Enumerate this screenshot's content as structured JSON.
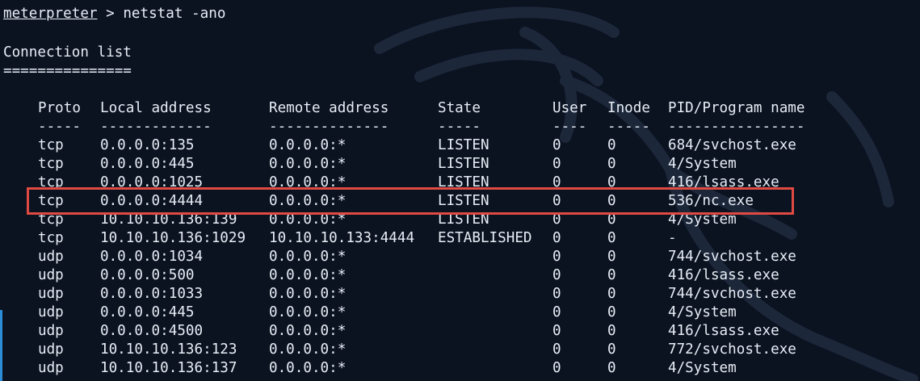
{
  "terminal": {
    "prompt": "meterpreter",
    "prompt_separator": " > ",
    "command": "netstat -ano",
    "section_title": "Connection list",
    "section_underline": "==============="
  },
  "table": {
    "headers": [
      "Proto",
      "Local address",
      "Remote address",
      "State",
      "User",
      "Inode",
      "PID/Program name"
    ],
    "header_underlines": [
      "-----",
      "-------------",
      "--------------",
      "-----",
      "----",
      "-----",
      "----------------"
    ],
    "rows": [
      [
        "tcp",
        "0.0.0.0:135",
        "0.0.0.0:*",
        "LISTEN",
        "0",
        "0",
        "684/svchost.exe"
      ],
      [
        "tcp",
        "0.0.0.0:445",
        "0.0.0.0:*",
        "LISTEN",
        "0",
        "0",
        "4/System"
      ],
      [
        "tcp",
        "0.0.0.0:1025",
        "0.0.0.0:*",
        "LISTEN",
        "0",
        "0",
        "416/lsass.exe"
      ],
      [
        "tcp",
        "0.0.0.0:4444",
        "0.0.0.0:*",
        "LISTEN",
        "0",
        "0",
        "536/nc.exe"
      ],
      [
        "tcp",
        "10.10.10.136:139",
        "0.0.0.0:*",
        "LISTEN",
        "0",
        "0",
        "4/System"
      ],
      [
        "tcp",
        "10.10.10.136:1029",
        "10.10.10.133:4444",
        "ESTABLISHED",
        "0",
        "0",
        "-"
      ],
      [
        "udp",
        "0.0.0.0:1034",
        "0.0.0.0:*",
        "",
        "0",
        "0",
        "744/svchost.exe"
      ],
      [
        "udp",
        "0.0.0.0:500",
        "0.0.0.0:*",
        "",
        "0",
        "0",
        "416/lsass.exe"
      ],
      [
        "udp",
        "0.0.0.0:1033",
        "0.0.0.0:*",
        "",
        "0",
        "0",
        "744/svchost.exe"
      ],
      [
        "udp",
        "0.0.0.0:445",
        "0.0.0.0:*",
        "",
        "0",
        "0",
        "4/System"
      ],
      [
        "udp",
        "0.0.0.0:4500",
        "0.0.0.0:*",
        "",
        "0",
        "0",
        "416/lsass.exe"
      ],
      [
        "udp",
        "10.10.10.136:123",
        "0.0.0.0:*",
        "",
        "0",
        "0",
        "772/svchost.exe"
      ],
      [
        "udp",
        "10.10.10.136:137",
        "0.0.0.0:*",
        "",
        "0",
        "0",
        "4/System"
      ]
    ],
    "highlighted_row_index": 3
  },
  "colors": {
    "background": "#0b1220",
    "text": "#e8eef6",
    "highlight_border": "#e04a43",
    "edge_accent": "#2b8dd6"
  },
  "icons": {
    "background": "kali-dragon-watermark"
  }
}
